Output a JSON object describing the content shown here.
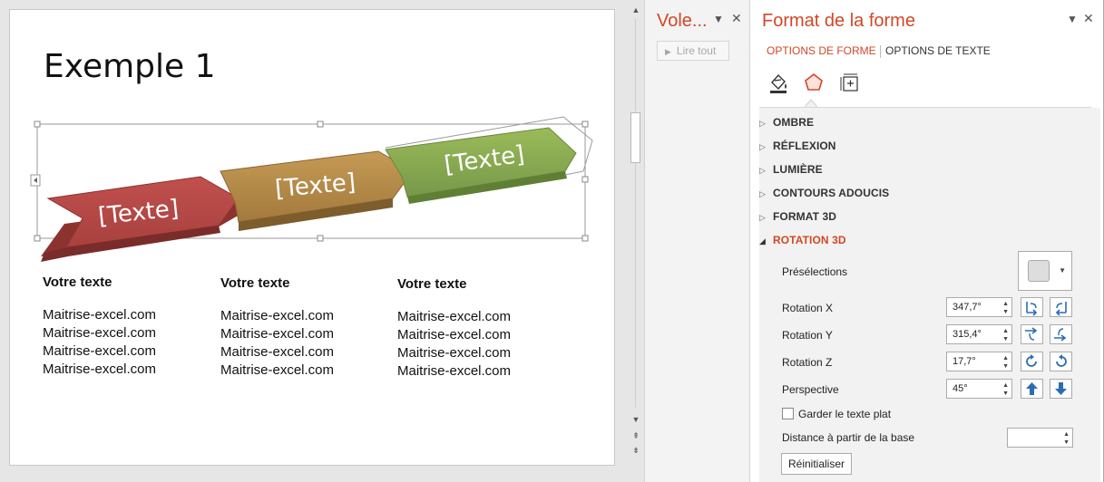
{
  "slide": {
    "title": "Exemple 1",
    "arrows": [
      {
        "label": "[Texte]",
        "color": "#b54a47"
      },
      {
        "label": "[Texte]",
        "color": "#b9894a"
      },
      {
        "label": "[Texte]",
        "color": "#86a85a"
      }
    ],
    "columns": [
      {
        "heading": "Votre texte",
        "lines": [
          "Maitrise-excel.com",
          "Maitrise-excel.com",
          "Maitrise-excel.com",
          "Maitrise-excel.com"
        ]
      },
      {
        "heading": "Votre texte",
        "lines": [
          "Maitrise-excel.com",
          "Maitrise-excel.com",
          "Maitrise-excel.com",
          "Maitrise-excel.com"
        ]
      },
      {
        "heading": "Votre texte",
        "lines": [
          "Maitrise-excel.com",
          "Maitrise-excel.com",
          "Maitrise-excel.com",
          "Maitrise-excel.com"
        ]
      }
    ]
  },
  "voice_pane": {
    "title": "Vole...",
    "read_all": "Lire tout"
  },
  "format_pane": {
    "title": "Format de la forme",
    "tabs": [
      "OPTIONS DE FORME",
      "OPTIONS DE TEXTE"
    ],
    "sections": [
      "OMBRE",
      "RÉFLEXION",
      "LUMIÈRE",
      "CONTOURS ADOUCIS",
      "FORMAT 3D",
      "ROTATION 3D"
    ],
    "presets_label": "Présélections",
    "rotation_x_label": "Rotation X",
    "rotation_x_value": "347,7°",
    "rotation_y_label": "Rotation Y",
    "rotation_y_value": "315,4°",
    "rotation_z_label": "Rotation Z",
    "rotation_z_value": "17,7°",
    "perspective_label": "Perspective",
    "perspective_value": "45°",
    "keep_flat_label": "Garder le texte plat",
    "distance_label": "Distance à partir de la base",
    "reset_label": "Réinitialiser"
  },
  "colors": {
    "accent": "#d24726",
    "rbtn_icon": "#2a6db3"
  }
}
